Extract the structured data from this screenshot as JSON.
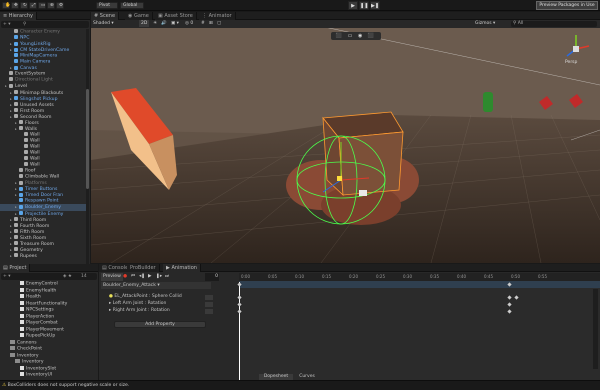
{
  "toolbar": {
    "pivot": "Pivot",
    "global": "Global",
    "play": "▶",
    "pause": "❚❚",
    "step": "▶❚",
    "preview_packages": "Preview Packages in Use"
  },
  "hierarchy": {
    "tab": "Hierarchy",
    "items": [
      {
        "label": "Character Enemy",
        "dim": true
      },
      {
        "label": "NPC",
        "prefab": true
      },
      {
        "label": "YoungLinkRig",
        "prefab": true
      },
      {
        "label": "CM StateDrivenCame",
        "prefab": true
      },
      {
        "label": "MiniMapCamera",
        "prefab": true
      },
      {
        "label": "Main Camera",
        "prefab": true
      },
      {
        "label": "Canvas",
        "prefab": true
      },
      {
        "label": "EventSystem"
      },
      {
        "label": "Directional Light",
        "dim": true
      },
      {
        "label": "Level"
      },
      {
        "label": "Minimap Blackouts"
      },
      {
        "label": "Slingshot Pickup",
        "prefab": true
      },
      {
        "label": "Unused Assets"
      },
      {
        "label": "First Room"
      },
      {
        "label": "Second Room"
      },
      {
        "label": "Floors"
      },
      {
        "label": "Walls"
      },
      {
        "label": "Wall"
      },
      {
        "label": "Wall"
      },
      {
        "label": "Wall"
      },
      {
        "label": "Wall"
      },
      {
        "label": "Wall"
      },
      {
        "label": "Wall"
      },
      {
        "label": "Roof"
      },
      {
        "label": "Climbable Wall"
      },
      {
        "label": "Platforms",
        "dim": true
      },
      {
        "label": "Timer Buttons",
        "prefab": true
      },
      {
        "label": "Timed Door Fran",
        "prefab": true
      },
      {
        "label": "Respawn Point",
        "prefab": true
      },
      {
        "label": "Boulder_Enemy",
        "prefab": true,
        "selected": true
      },
      {
        "label": "Projectile Enemy",
        "prefab": true
      },
      {
        "label": "Third Room"
      },
      {
        "label": "Fourth Room"
      },
      {
        "label": "Fifth Room"
      },
      {
        "label": "Sixth Room"
      },
      {
        "label": "Treasure Room"
      },
      {
        "label": "Geometry"
      },
      {
        "label": "Rupees"
      }
    ]
  },
  "scene_tabs": {
    "scene": "Scene",
    "game": "Game",
    "asset_store": "Asset Store",
    "animator": "Animator"
  },
  "scene_toolbar": {
    "shading": "Shaded",
    "mode": "2D",
    "gizmos": "Gizmos",
    "search": "All",
    "persp": "Persp"
  },
  "project": {
    "tab": "Project",
    "items": [
      {
        "label": "EnemyControl",
        "kind": "file"
      },
      {
        "label": "EnemyHealth",
        "kind": "file"
      },
      {
        "label": "Health",
        "kind": "file"
      },
      {
        "label": "HeartFunctionality",
        "kind": "file"
      },
      {
        "label": "NPCSettings",
        "kind": "file"
      },
      {
        "label": "PlayerAction",
        "kind": "file"
      },
      {
        "label": "PlayerCombat",
        "kind": "file"
      },
      {
        "label": "PlayerMovement",
        "kind": "file"
      },
      {
        "label": "RupeePickUp",
        "kind": "file"
      },
      {
        "label": "Cannons",
        "kind": "folder"
      },
      {
        "label": "CheckPoint",
        "kind": "folder"
      },
      {
        "label": "Inventory",
        "kind": "folder"
      },
      {
        "label": "Inventory",
        "kind": "folder"
      },
      {
        "label": "InventorySlot",
        "kind": "file"
      },
      {
        "label": "InventoryUI",
        "kind": "file"
      }
    ],
    "count": "14"
  },
  "animation": {
    "tabs": [
      "Console",
      "ProBuilder",
      "Animation"
    ],
    "preview": "Preview",
    "frame": "0",
    "clip": "Boulder_Enemy_Attack",
    "sample_label": "Sa",
    "properties": [
      "EL_AttackPoint : Sphere Collid",
      "▸ Left Arm Joint : Rotation",
      "▸ Right Arm Joint : Rotation"
    ],
    "add_property": "Add Property",
    "ruler": [
      "0:00",
      "0:05",
      "0:10",
      "0:15",
      "0:20",
      "0:25",
      "0:30",
      "0:35",
      "0:40",
      "0:45",
      "0:50",
      "0:55"
    ],
    "dopesheet": "Dopesheet",
    "curves": "Curves"
  },
  "status": {
    "message": "BoxColliders does not support negative scale or size."
  }
}
